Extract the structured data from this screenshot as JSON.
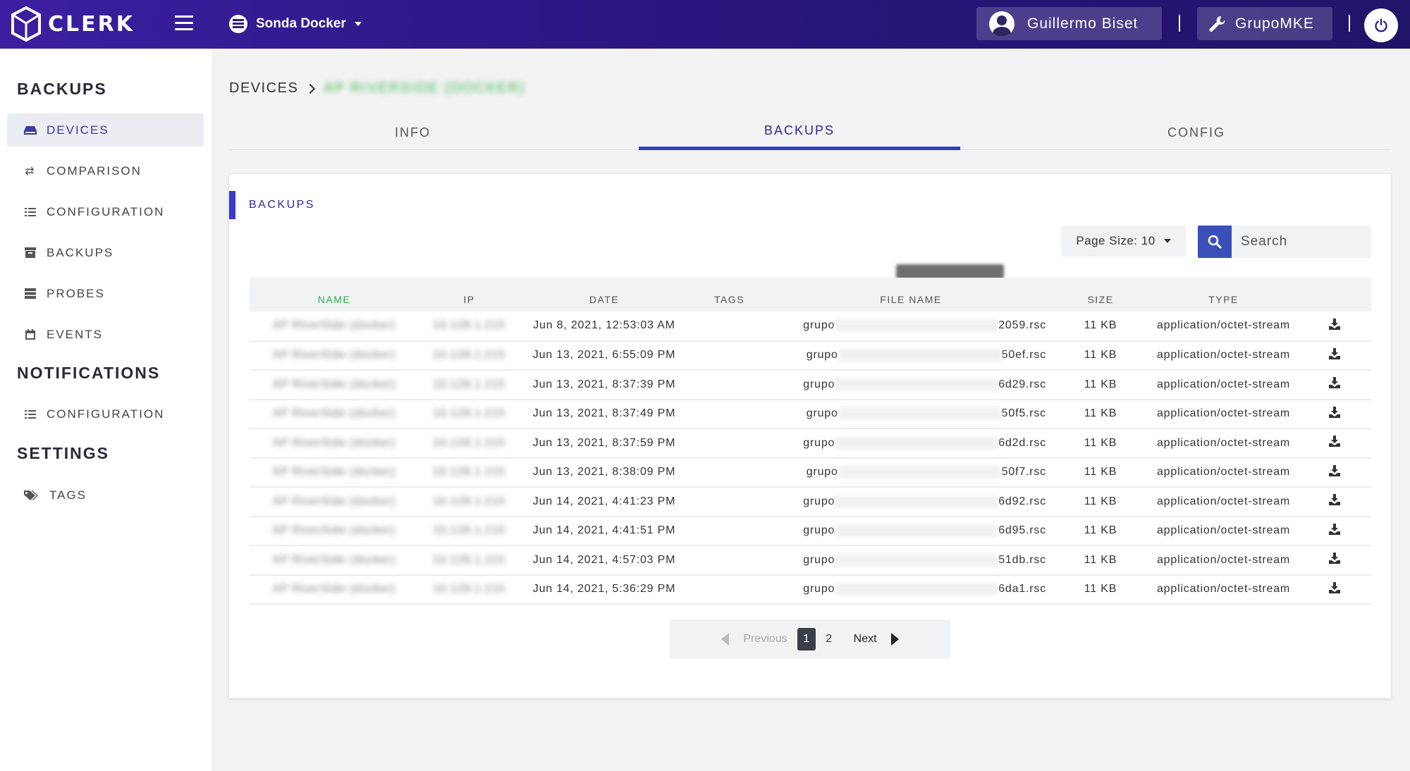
{
  "header": {
    "brand": "CLERK",
    "project": "Sonda Docker",
    "user": "Guillermo Biset",
    "org": "GrupoMKE"
  },
  "sidebar": {
    "sections": [
      {
        "title": "BACKUPS",
        "items": [
          {
            "label": "DEVICES",
            "icon": "hdd-icon",
            "active": true
          },
          {
            "label": "COMPARISON",
            "icon": "exchange-icon"
          },
          {
            "label": "CONFIGURATION",
            "icon": "tasks-icon"
          },
          {
            "label": "BACKUPS",
            "icon": "archive-icon"
          },
          {
            "label": "PROBES",
            "icon": "server-icon"
          },
          {
            "label": "EVENTS",
            "icon": "calendar-icon"
          }
        ]
      },
      {
        "title": "NOTIFICATIONS",
        "items": [
          {
            "label": "CONFIGURATION",
            "icon": "tasks-icon"
          }
        ]
      },
      {
        "title": "SETTINGS",
        "items": [
          {
            "label": "TAGS",
            "icon": "tags-icon"
          }
        ]
      }
    ]
  },
  "breadcrumb": {
    "parent": "DEVICES",
    "current": "AP RIVERSIDE (DOCKER)"
  },
  "tabs": [
    {
      "label": "INFO"
    },
    {
      "label": "BACKUPS",
      "active": true
    },
    {
      "label": "CONFIG"
    }
  ],
  "card": {
    "title": "BACKUPS",
    "page_size_label": "Page Size: 10",
    "search_placeholder": "Search"
  },
  "table": {
    "columns": [
      "NAME",
      "IP",
      "DATE",
      "TAGS",
      "FILE NAME",
      "SIZE",
      "TYPE"
    ],
    "sorted_column": "NAME",
    "rows": [
      {
        "name": "AP RiverSide (docker)",
        "ip": "10.128.1.215",
        "date": "Jun 8, 2021, 12:53:03 AM",
        "tags": "",
        "file_prefix": "grupo",
        "file_suffix": "2059.rsc",
        "size": "11 KB",
        "type": "application/octet-stream"
      },
      {
        "name": "AP RiverSide (docker)",
        "ip": "10.128.1.215",
        "date": "Jun 13, 2021, 6:55:09 PM",
        "tags": "",
        "file_prefix": "grupo",
        "file_suffix": "50ef.rsc",
        "size": "11 KB",
        "type": "application/octet-stream"
      },
      {
        "name": "AP RiverSide (docker)",
        "ip": "10.128.1.215",
        "date": "Jun 13, 2021, 8:37:39 PM",
        "tags": "",
        "file_prefix": "grupo",
        "file_suffix": "6d29.rsc",
        "size": "11 KB",
        "type": "application/octet-stream"
      },
      {
        "name": "AP RiverSide (docker)",
        "ip": "10.128.1.215",
        "date": "Jun 13, 2021, 8:37:49 PM",
        "tags": "",
        "file_prefix": "grupo",
        "file_suffix": "50f5.rsc",
        "size": "11 KB",
        "type": "application/octet-stream"
      },
      {
        "name": "AP RiverSide (docker)",
        "ip": "10.128.1.215",
        "date": "Jun 13, 2021, 8:37:59 PM",
        "tags": "",
        "file_prefix": "grupo",
        "file_suffix": "6d2d.rsc",
        "size": "11 KB",
        "type": "application/octet-stream"
      },
      {
        "name": "AP RiverSide (docker)",
        "ip": "10.128.1.215",
        "date": "Jun 13, 2021, 8:38:09 PM",
        "tags": "",
        "file_prefix": "grupo",
        "file_suffix": "50f7.rsc",
        "size": "11 KB",
        "type": "application/octet-stream"
      },
      {
        "name": "AP RiverSide (docker)",
        "ip": "10.128.1.215",
        "date": "Jun 14, 2021, 4:41:23 PM",
        "tags": "",
        "file_prefix": "grupo",
        "file_suffix": "6d92.rsc",
        "size": "11 KB",
        "type": "application/octet-stream"
      },
      {
        "name": "AP RiverSide (docker)",
        "ip": "10.128.1.215",
        "date": "Jun 14, 2021, 4:41:51 PM",
        "tags": "",
        "file_prefix": "grupo",
        "file_suffix": "6d95.rsc",
        "size": "11 KB",
        "type": "application/octet-stream"
      },
      {
        "name": "AP RiverSide (docker)",
        "ip": "10.128.1.215",
        "date": "Jun 14, 2021, 4:57:03 PM",
        "tags": "",
        "file_prefix": "grupo",
        "file_suffix": "51db.rsc",
        "size": "11 KB",
        "type": "application/octet-stream"
      },
      {
        "name": "AP RiverSide (docker)",
        "ip": "10.128.1.215",
        "date": "Jun 14, 2021, 5:36:29 PM",
        "tags": "",
        "file_prefix": "grupo",
        "file_suffix": "6da1.rsc",
        "size": "11 KB",
        "type": "application/octet-stream"
      }
    ]
  },
  "pagination": {
    "previous": "Previous",
    "next": "Next",
    "pages": [
      "1",
      "2"
    ],
    "current": "1"
  },
  "colors": {
    "header_bg": "#2b1580",
    "accent": "#3a3acc",
    "sorted_header": "#2eae4a"
  }
}
